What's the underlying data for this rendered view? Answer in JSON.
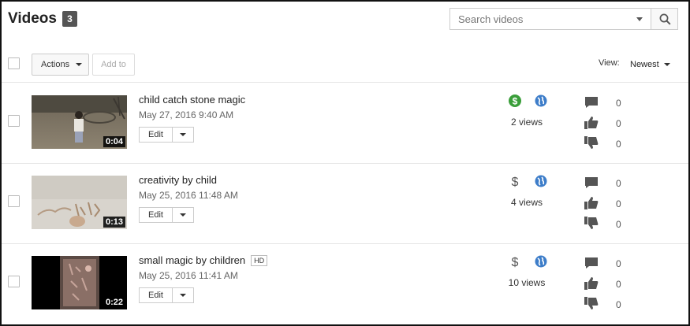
{
  "header": {
    "title": "Videos",
    "count": "3"
  },
  "search": {
    "placeholder": "Search videos",
    "value": ""
  },
  "toolbar": {
    "actions_label": "Actions",
    "add_to_label": "Add to",
    "view_label": "View:",
    "sort_value": "Newest"
  },
  "colors": {
    "monetized_green": "#3a9e3a",
    "globe_blue": "#3d7dc9",
    "icon_gray": "#555555"
  },
  "videos": [
    {
      "title": "child catch stone magic",
      "hd": "",
      "date": "May 27, 2016 9:40 AM",
      "duration": "0:04",
      "edit_label": "Edit",
      "views": "2 views",
      "comments": "0",
      "likes": "0",
      "dislikes": "0",
      "monetization": "monetized",
      "privacy": "public"
    },
    {
      "title": "creativity by child",
      "hd": "",
      "date": "May 25, 2016 11:48 AM",
      "duration": "0:13",
      "edit_label": "Edit",
      "views": "4 views",
      "comments": "0",
      "likes": "0",
      "dislikes": "0",
      "monetization": "not-monetized",
      "privacy": "public"
    },
    {
      "title": "small magic by children",
      "hd": "HD",
      "date": "May 25, 2016 11:41 AM",
      "duration": "0:22",
      "edit_label": "Edit",
      "views": "10 views",
      "comments": "0",
      "likes": "0",
      "dislikes": "0",
      "monetization": "not-monetized",
      "privacy": "public"
    }
  ]
}
